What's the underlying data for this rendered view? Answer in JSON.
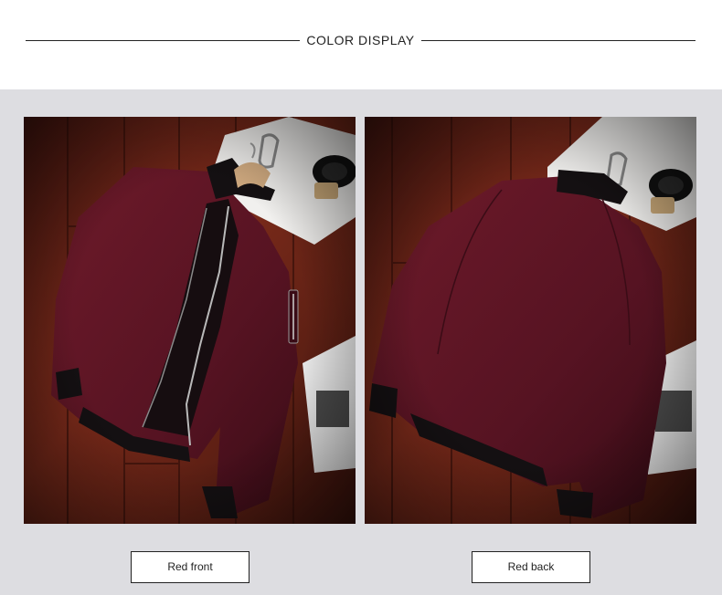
{
  "section": {
    "title": "COLOR DISPLAY"
  },
  "products": [
    {
      "caption": "Red front",
      "view": "front",
      "color": "#5e1422"
    },
    {
      "caption": "Red back",
      "view": "back",
      "color": "#5e1422"
    }
  ],
  "colors": {
    "gallery_background": "#dddde1",
    "wood": "#6b2216",
    "jacket": "#5e1422",
    "rib_trim": "#141012"
  }
}
